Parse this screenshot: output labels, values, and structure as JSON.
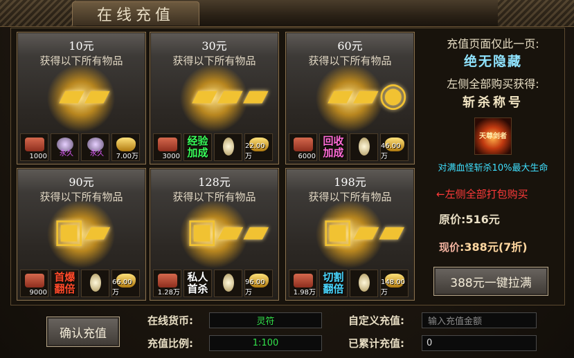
{
  "window": {
    "title": "在线充值"
  },
  "packages": [
    {
      "price": "10元",
      "subtitle": "获得以下所有物品",
      "items": [
        {
          "icon": "meat-icon",
          "count": "1000"
        },
        {
          "icon": "stone-icon",
          "tag": "永久"
        },
        {
          "icon": "stone-icon",
          "tag": "永久"
        },
        {
          "icon": "ingot-icon",
          "count": "7.00万"
        }
      ]
    },
    {
      "price": "30元",
      "subtitle": "获得以下所有物品",
      "items": [
        {
          "icon": "meat-icon",
          "count": "3000"
        },
        {
          "icon": "label",
          "text": "经验加成"
        },
        {
          "icon": "bag-icon"
        },
        {
          "icon": "ingot-icon",
          "count": "22.00万"
        }
      ]
    },
    {
      "price": "60元",
      "subtitle": "获得以下所有物品",
      "items": [
        {
          "icon": "meat-icon",
          "count": "6000"
        },
        {
          "icon": "label",
          "text": "回收加成"
        },
        {
          "icon": "bag-icon"
        },
        {
          "icon": "ingot-icon",
          "count": "46.00万"
        }
      ]
    },
    {
      "price": "90元",
      "subtitle": "获得以下所有物品",
      "items": [
        {
          "icon": "meat-icon",
          "count": "9000"
        },
        {
          "icon": "label",
          "text": "首爆翻倍"
        },
        {
          "icon": "bag-icon"
        },
        {
          "icon": "ingot-icon",
          "count": "66.00万"
        }
      ]
    },
    {
      "price": "128元",
      "subtitle": "获得以下所有物品",
      "items": [
        {
          "icon": "meat-icon",
          "count": "1.28万"
        },
        {
          "icon": "label",
          "text": "私人首杀"
        },
        {
          "icon": "bag-icon"
        },
        {
          "icon": "ingot-icon",
          "count": "96.00万"
        }
      ]
    },
    {
      "price": "198元",
      "subtitle": "获得以下所有物品",
      "items": [
        {
          "icon": "meat-icon",
          "count": "1.98万"
        },
        {
          "icon": "label",
          "text": "切割翻倍"
        },
        {
          "icon": "bag-icon"
        },
        {
          "icon": "ingot-icon",
          "count": "148.00万"
        }
      ]
    }
  ],
  "side": {
    "line1": "充值页面仅此一页:",
    "line2": "绝无隐藏",
    "line3": "左侧全部购买获得:",
    "line4": "斩杀称号",
    "title_badge": "天尊剑者",
    "line5": "对满血怪斩杀10%最大生命",
    "line6": "←左侧全部打包购买",
    "original_price": "原价:516元",
    "current_label": "现价",
    "current_price": ":388元(7折)",
    "buy_all_button": "388元一键拉满"
  },
  "bottom": {
    "confirm_button": "确认充值",
    "currency_label": "在线货币:",
    "currency_value": "灵符",
    "ratio_label": "充值比例:",
    "ratio_value": "1:100",
    "custom_label": "自定义充值:",
    "custom_placeholder": "输入充值金额",
    "total_label": "已累计充值:",
    "total_value": "0"
  },
  "colors": {
    "tag_exp": "#39ff5a",
    "tag_recycle": "#ff6bd6",
    "tag_drop": "#ff4a2a",
    "tag_kill": "#ffffff",
    "tag_cut": "#4ad7ff"
  }
}
